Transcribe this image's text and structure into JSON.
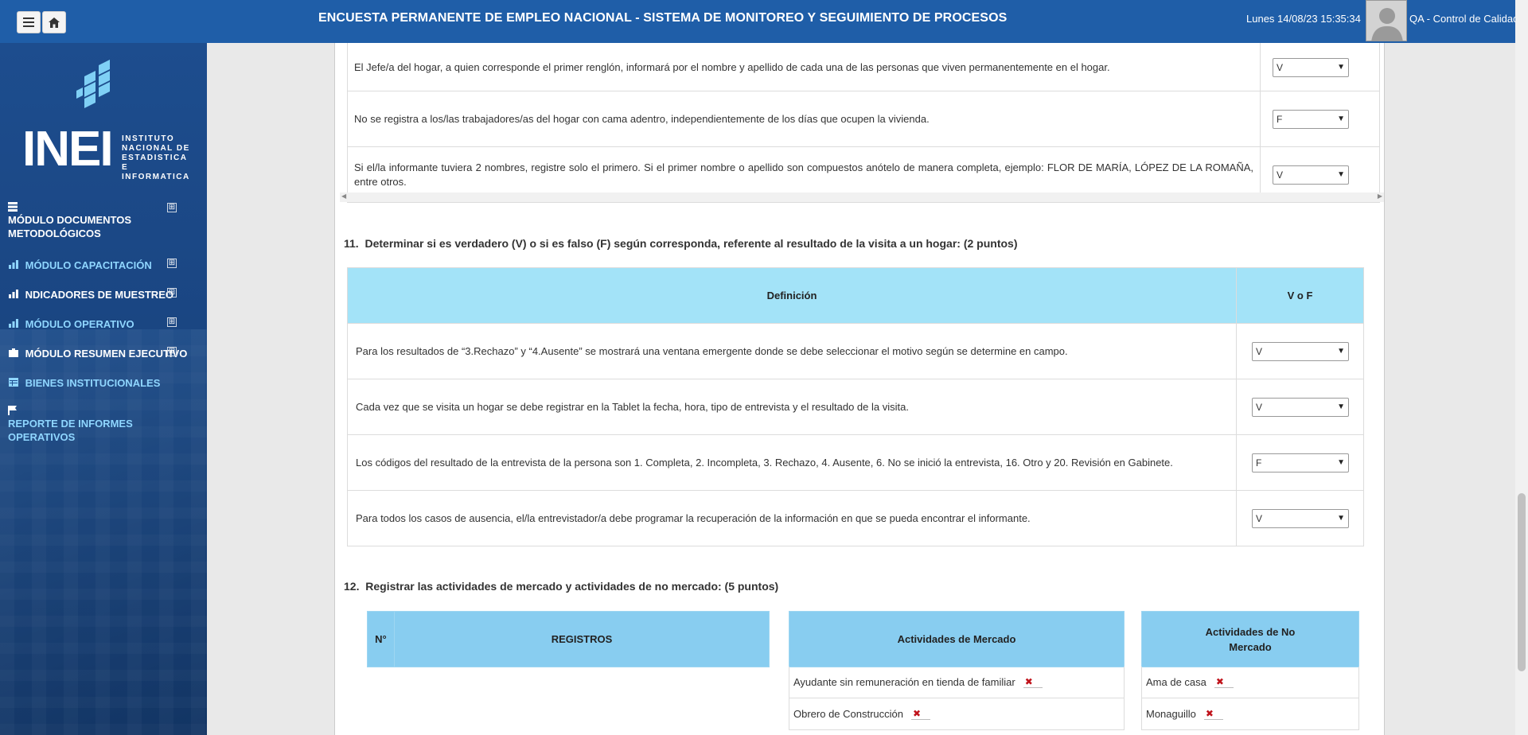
{
  "header": {
    "title": "ENCUESTA PERMANENTE DE EMPLEO NACIONAL - SISTEMA DE MONITOREO Y SEGUIMIENTO DE PROCESOS",
    "datetime": "Lunes 14/08/23 15:35:34",
    "user": "QA - Control de Calidad"
  },
  "logo": {
    "name": "INEI",
    "subtitle": [
      "INSTITUTO",
      "NACIONAL DE",
      "ESTADISTICA E",
      "INFORMATICA"
    ]
  },
  "sidebar": {
    "items": [
      {
        "label": "MÓDULO DOCUMENTOS METODOLÓGICOS"
      },
      {
        "label": "MÓDULO CAPACITACIÓN"
      },
      {
        "label": "NDICADORES DE MUESTREO"
      },
      {
        "label": "MÓDULO OPERATIVO"
      },
      {
        "label": "MÓDULO RESUMEN EJECUTIVO"
      },
      {
        "label": "BIENES INSTITUCIONALES"
      },
      {
        "label": "REPORTE DE INFORMES OPERATIVOS"
      }
    ],
    "plus": "⊞"
  },
  "q10": {
    "rows": [
      {
        "text": "El Jefe/a del hogar, a quien corresponde el primer renglón, informará por el nombre y apellido de cada una de las personas que viven permanentemente en el hogar.",
        "value": "V"
      },
      {
        "text": "No se registra a los/las trabajadores/as del hogar con cama adentro, independientemente de los días que ocupen la vivienda.",
        "value": "F"
      },
      {
        "text": "Si el/la informante tuviera 2 nombres, registre solo el primero. Si el primer nombre o apellido son compuestos anótelo de manera completa, ejemplo: FLOR DE MARÍA, LÓPEZ DE LA ROMAÑA, entre otros.",
        "value": "V"
      }
    ]
  },
  "q11": {
    "number": "11.",
    "title": "Determinar si es verdadero (V) o si es falso (F) según corresponda, referente al resultado de la visita a un hogar: (2 puntos)",
    "col_def": "Definición",
    "col_vf": "V o F",
    "rows": [
      {
        "text": "Para los resultados de “3.Rechazo” y “4.Ausente” se mostrará una ventana emergente donde se debe seleccionar el motivo según se determine en campo.",
        "value": "V"
      },
      {
        "text": "Cada vez que se visita un hogar se debe registrar en la Tablet la fecha, hora, tipo de entrevista y el resultado de la visita.",
        "value": "V"
      },
      {
        "text": "Los códigos del resultado de la entrevista de la persona son 1. Completa, 2. Incompleta, 3. Rechazo, 4. Ausente, 6. No se inició la entrevista, 16. Otro y 20. Revisión en Gabinete.",
        "value": "F"
      },
      {
        "text": "Para todos los casos de ausencia, el/la entrevistador/a debe programar la recuperación de la información en que se pueda encontrar el informante.",
        "value": "V"
      }
    ]
  },
  "q12": {
    "number": "12.",
    "title": "Registrar las actividades de mercado y actividades de no mercado: (5 puntos)",
    "col_n": "N°",
    "col_reg": "REGISTROS",
    "col_mercado": "Actividades de Mercado",
    "col_no_mercado": "Actividades de No Mercado",
    "mercado": [
      "Ayudante sin remuneración en tienda de familiar",
      "Obrero de Construcción"
    ],
    "no_mercado": [
      "Ama de casa",
      "Monaguillo"
    ],
    "remove_symbol": "✖"
  }
}
